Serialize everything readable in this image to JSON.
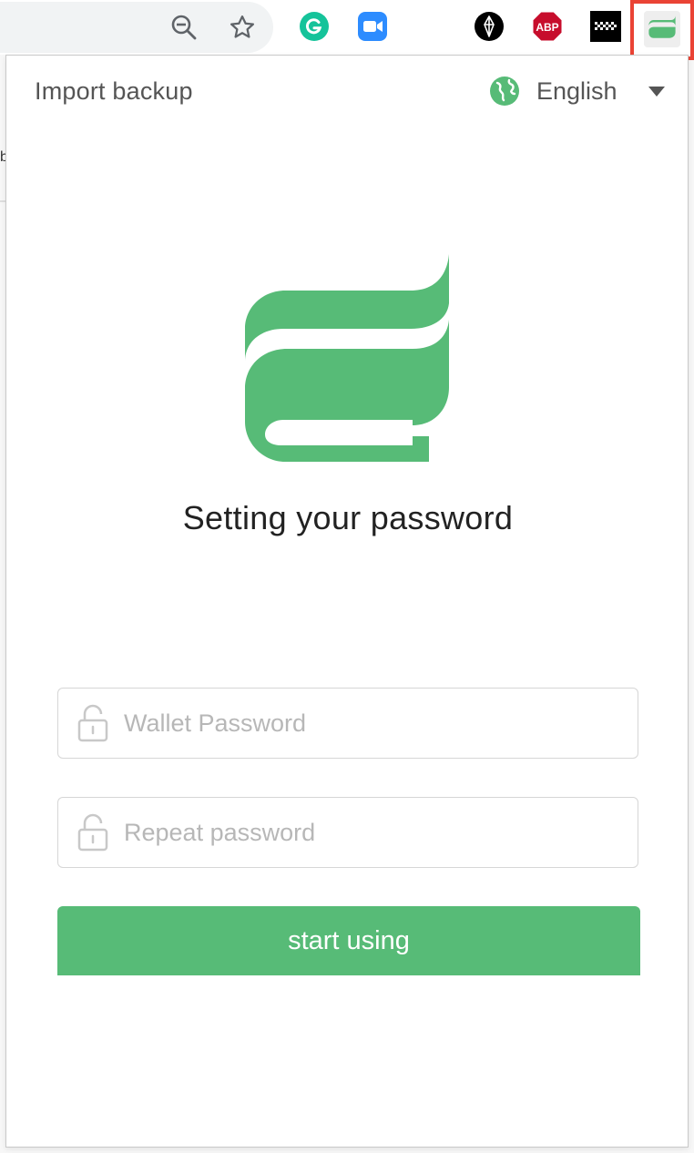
{
  "browser": {
    "toolbar_icons": [
      "zoom-out-icon",
      "star-icon"
    ],
    "extensions": [
      {
        "name": "grammarly-extension-icon",
        "label": "G",
        "color": "#15c39a"
      },
      {
        "name": "zoom-extension-icon",
        "label": "",
        "color": "#2d8cff"
      },
      {
        "name": "eos-extension-icon",
        "label": "",
        "color": "#000000"
      },
      {
        "name": "adblock-plus-extension-icon",
        "label": "ABP",
        "color": "#c70d2c"
      },
      {
        "name": "checkered-flag-extension-icon",
        "label": "",
        "color": "#000000"
      },
      {
        "name": "wallet-extension-icon",
        "label": "",
        "color": "#57bb77"
      }
    ],
    "highlight_color": "#ea4335",
    "page_behind_char": "b"
  },
  "popup": {
    "import_label": "Import backup",
    "language": {
      "label": "English",
      "icon": "globe-icon"
    },
    "title": "Setting your password",
    "fields": [
      {
        "placeholder": "Wallet Password",
        "icon": "lock-icon"
      },
      {
        "placeholder": "Repeat password",
        "icon": "lock-icon"
      }
    ],
    "submit_label": "start using",
    "accent_color": "#57bb77"
  }
}
